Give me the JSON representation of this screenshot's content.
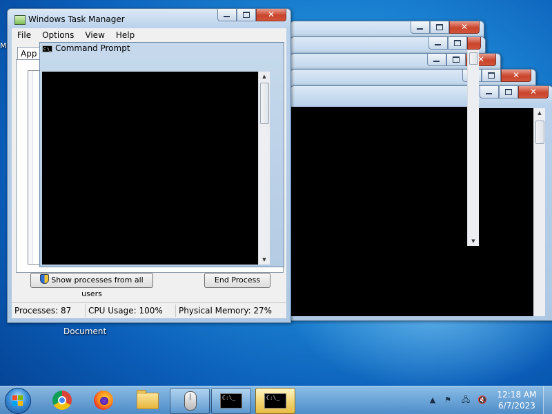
{
  "taskmgr": {
    "title": "Windows Task Manager",
    "menu": [
      "File",
      "Options",
      "View",
      "Help"
    ],
    "tab_applications": "App",
    "show_all_label": "Show processes from all users",
    "end_process_label": "End Process",
    "status": {
      "processes": "Processes: 87",
      "cpu": "CPU Usage: 100%",
      "memory": "Physical Memory: 27%"
    }
  },
  "cmd": {
    "title": "Command Prompt"
  },
  "desktop": {
    "icon_label": "Document",
    "edge_fragment": "M"
  },
  "taskbar": {
    "clock_time": "12:18 AM",
    "clock_date": "6/7/2023",
    "console_glyph": "C:\\_"
  },
  "colors": {
    "window_frame": "#b9d1ea",
    "console_bg": "#000000",
    "taskbar_active": "#f3d677"
  }
}
